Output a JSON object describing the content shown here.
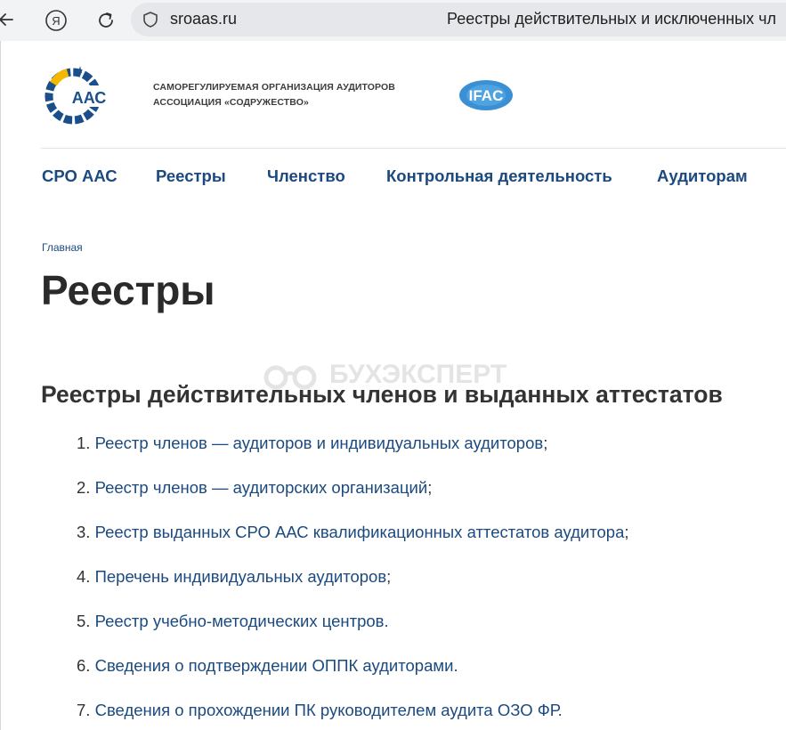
{
  "browser": {
    "url": "sroaas.ru",
    "tab_title": "Реестры действительных и исключенных чл"
  },
  "header": {
    "logo_text": "ААС",
    "org_line1": "САМОРЕГУЛИРУЕМАЯ ОРГАНИЗАЦИЯ АУДИТОРОВ",
    "org_line2": "АССОЦИАЦИЯ «СОДРУЖЕСТВО»",
    "ifac_logo_text": "IFAC"
  },
  "nav": {
    "items": [
      "СРО ААС",
      "Реестры",
      "Членство",
      "Контрольная деятельность",
      "Аудиторам"
    ]
  },
  "breadcrumb": "Главная",
  "page_title": "Реестры",
  "watermark": "БУХЭКСПЕРТ",
  "section_title": "Реестры действительных членов и выданных аттестатов",
  "list": [
    {
      "num": "1.",
      "link": "Реестр членов — аудиторов и индивидуальных аудиторов",
      "suffix": ";"
    },
    {
      "num": "2.",
      "link": "Реестр членов — аудиторских организаций",
      "suffix": ";"
    },
    {
      "num": "3.",
      "link": "Реестр выданных СРО ААС квалификационных аттестатов аудитора",
      "suffix": ";"
    },
    {
      "num": "4.",
      "link": "Перечень индивидуальных аудиторов",
      "suffix": ";"
    },
    {
      "num": "5.",
      "link": "Реестр учебно-методических центров.",
      "suffix": ""
    },
    {
      "num": "6.",
      "link": "Сведения о подтверждении ОППК аудиторами.",
      "suffix": ""
    },
    {
      "num": "7.",
      "link": "Сведения о прохождении ПК руководителем аудита ОЗО ФР.",
      "suffix": ""
    }
  ],
  "colors": {
    "link": "#1c4a7e",
    "heading": "#2a2a2a",
    "logo_blue": "#1b4f8c",
    "logo_yellow": "#f5b800"
  }
}
